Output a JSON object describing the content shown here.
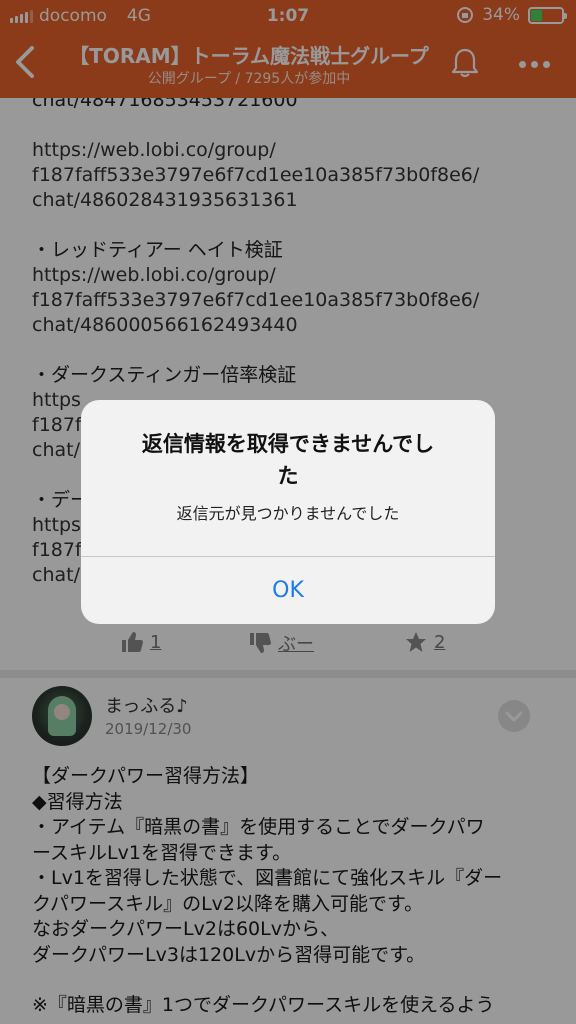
{
  "status_bar": {
    "carrier": "docomo",
    "network": "4G",
    "time": "1:07",
    "battery": "34%"
  },
  "header": {
    "title": "【TORAM】トーラム魔法戦士グループ",
    "subtitle": "公開グループ / 7295人が参加中",
    "back_icon": "chevron-left-icon",
    "bell_icon": "bell-icon",
    "more_icon": "ellipsis-icon"
  },
  "post1": {
    "lines": [
      "chat/484716853453721600",
      "https://web.lobi.co/group/",
      "f187faff533e3797e6f7cd1ee10a385f73b0f8e6/",
      "chat/486028431935631361",
      "・レッドティアー ヘイト検証",
      "https://web.lobi.co/group/",
      "f187faff533e3797e6f7cd1ee10a385f73b0f8e6/",
      "chat/486000566162493440",
      "・ダークスティンガー倍率検証",
      "https",
      "f187f",
      "chat/",
      "・デー",
      "https",
      "f187f",
      "chat/"
    ],
    "reactions": {
      "like_count": "1",
      "dislike_label": "ぶー",
      "star_count": "2"
    }
  },
  "post2": {
    "username": "まっふる♪",
    "date": "2019/12/30",
    "lines": [
      "【ダークパワー習得方法】",
      "◆習得方法",
      "・アイテム『暗黒の書』を使用することでダークパワ",
      "ースキルLv1を習得できます。",
      "・Lv1を習得した状態で、図書館にて強化スキル『ダー",
      "クパワースキル』のLv2以降を購入可能です。",
      "なおダークパワーLv2は60Lvから、",
      "ダークパワーLv3は120Lvから習得可能です。",
      "※『暗黒の書』1つでダークパワースキルを使えるよう"
    ]
  },
  "dialog": {
    "title_line1": "返信情報を取得できませんでし",
    "title_line2": "た",
    "message": "返信元が見つかりませんでした",
    "ok_label": "OK"
  },
  "colors": {
    "header_bg": "#e8612c",
    "link_blue": "#1a7cf5",
    "battery_green": "#4cd964"
  }
}
